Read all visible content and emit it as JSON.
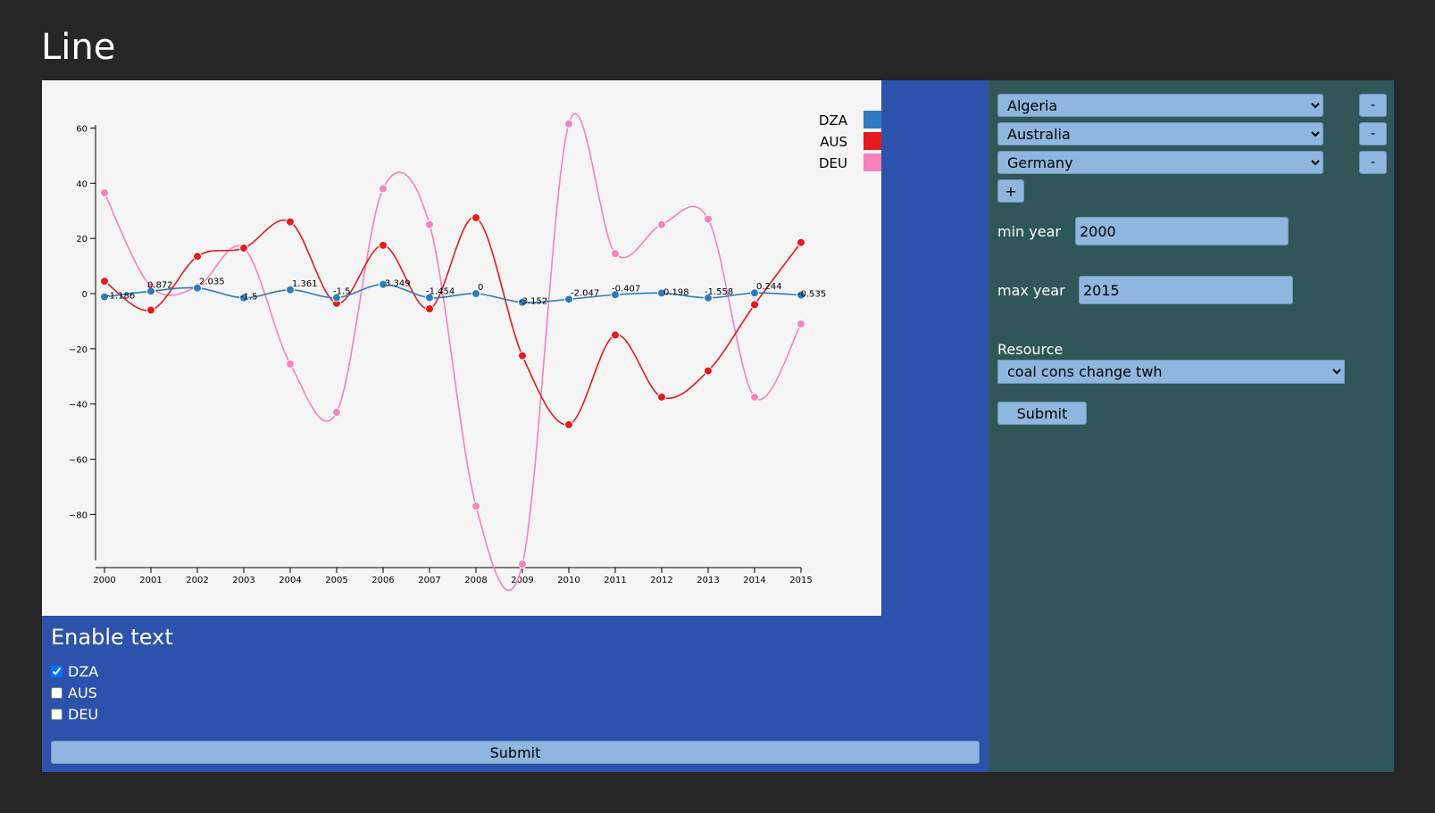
{
  "page": {
    "title": "Line"
  },
  "chart_data": {
    "type": "line",
    "x": [
      2000,
      2001,
      2002,
      2003,
      2004,
      2005,
      2006,
      2007,
      2008,
      2009,
      2010,
      2011,
      2012,
      2013,
      2014,
      2015
    ],
    "series": [
      {
        "name": "DZA",
        "color": "#2f7bbd",
        "values": [
          -1.186,
          0.872,
          2.035,
          -1.5,
          1.361,
          -1.5,
          3.349,
          -1.454,
          0,
          -3.152,
          -2.047,
          -0.407,
          0.198,
          -1.558,
          0.244,
          -0.535
        ]
      },
      {
        "name": "AUS",
        "color": "#e41a1c",
        "values": [
          4.5,
          -6,
          13.5,
          16.5,
          26,
          -3.5,
          17.5,
          -5.5,
          27.5,
          -22.5,
          -47.5,
          -15,
          -37.5,
          -28,
          -4,
          18.5
        ]
      },
      {
        "name": "DEU",
        "color": "#f781bf",
        "values": [
          36.5,
          2.5,
          2.5,
          16.5,
          -25.5,
          -43,
          38,
          25,
          -77,
          -98,
          61.5,
          14.5,
          25,
          27,
          -37.5,
          -11
        ]
      }
    ],
    "data_labels_series": "DZA",
    "data_labels": [
      "-1.186",
      "0.872",
      "2.035",
      "-1.5",
      "1.361",
      "-1.5",
      "3.349",
      "-1.454",
      "0",
      "-3.152",
      "-2.047",
      "-0.407",
      "0.198",
      "-1.558",
      "0.244",
      "-0.535"
    ],
    "y_ticks": [
      60,
      40,
      20,
      0,
      -20,
      -40,
      -60,
      -80
    ],
    "ylim": [
      -100,
      62
    ],
    "xlim": [
      2000,
      2015
    ],
    "grid": false,
    "legend_placement": "top-right"
  },
  "text_toggles": {
    "title": "Enable text",
    "items": [
      {
        "label": "DZA",
        "checked": true
      },
      {
        "label": "AUS",
        "checked": false
      },
      {
        "label": "DEU",
        "checked": false
      }
    ],
    "submit_label": "Submit"
  },
  "controls": {
    "countries": [
      {
        "value": "Algeria",
        "remove_label": "-"
      },
      {
        "value": "Australia",
        "remove_label": "-"
      },
      {
        "value": "Germany",
        "remove_label": "-"
      }
    ],
    "add_label": "+",
    "min_year_label": "min year",
    "min_year_value": "2000",
    "max_year_label": "max year",
    "max_year_value": "2015",
    "resource_label": "Resource",
    "resource_value": "coal cons change twh",
    "submit_label": "Submit"
  }
}
